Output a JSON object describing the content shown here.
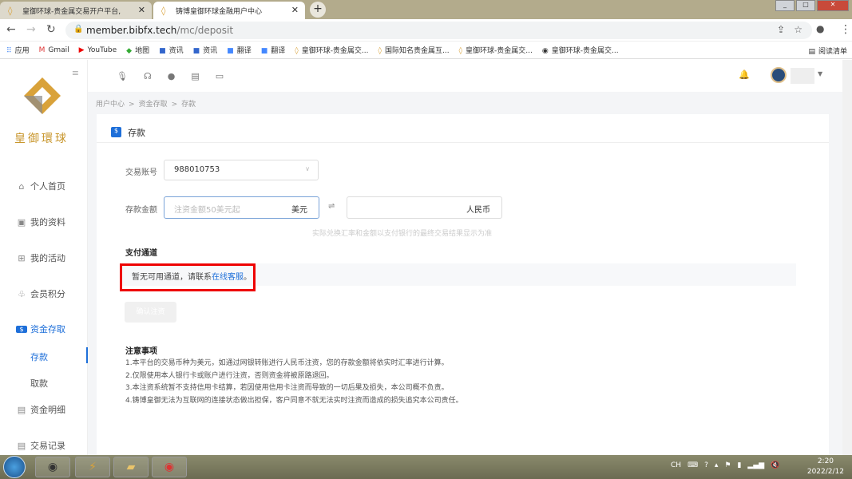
{
  "browser": {
    "tabs": [
      {
        "label": "皇御环球-贵金属交易开户平台,"
      },
      {
        "label": "铸博皇御环球金融用户中心"
      }
    ],
    "url_host": "member.bibfx.tech",
    "url_path": "/mc/deposit",
    "bookmarks": [
      "应用",
      "Gmail",
      "YouTube",
      "地图",
      "资讯",
      "资讯",
      "翻译",
      "翻译",
      "皇御环球-贵金属交...",
      "国际知名贵金属互...",
      "皇御环球-贵金属交...",
      "皇御环球-贵金属交..."
    ],
    "reading_list": "阅读清单"
  },
  "sidebar": {
    "logo_text": "皇御環球",
    "items": [
      {
        "label": "个人首页",
        "icon": "home-icon"
      },
      {
        "label": "我的资料",
        "icon": "profile-icon"
      },
      {
        "label": "我的活动",
        "icon": "gift-icon"
      },
      {
        "label": "会员积分",
        "icon": "points-icon"
      },
      {
        "label": "资金存取",
        "icon": "money-icon"
      },
      {
        "label": "存款"
      },
      {
        "label": "取款"
      },
      {
        "label": "资金明细",
        "icon": "list-icon"
      },
      {
        "label": "交易记录",
        "icon": "record-icon"
      }
    ]
  },
  "breadcrumb": [
    "用户中心",
    "资金存取",
    "存款"
  ],
  "card": {
    "title": "存款",
    "account_label": "交易账号",
    "account_value": "988010753",
    "amount_label": "存款金额",
    "amount_placeholder": "注资金额50美元起",
    "usd_unit": "美元",
    "cny_unit": "人民币",
    "hint": "实际兑换汇率和金额以支付银行的最终交易结果显示为准",
    "channel_title": "支付通道",
    "no_channel": "暂无可用通道，请联系",
    "no_channel_link": "在线客服",
    "no_channel_end": "。",
    "confirm": "确认注资",
    "notes_title": "注意事项",
    "notes": [
      "1.本平台的交易币种为美元，如通过网银转账进行人民币注资，您的存款金额将依实时汇率进行计算。",
      "2.仅限使用本人银行卡或账户进行注资，否则资金将被原路退回。",
      "3.本注资系统暂不支持信用卡结算，若因使用信用卡注资而导致的一切后果及损失，本公司概不负责。",
      "4.铸博皇御无法为互联网的连接状态做出担保，客户同意不就无法实时注资而造成的损失追究本公司责任。"
    ]
  },
  "taskbar": {
    "lang": "CH",
    "time": "2:20",
    "date": "2022/2/12"
  }
}
